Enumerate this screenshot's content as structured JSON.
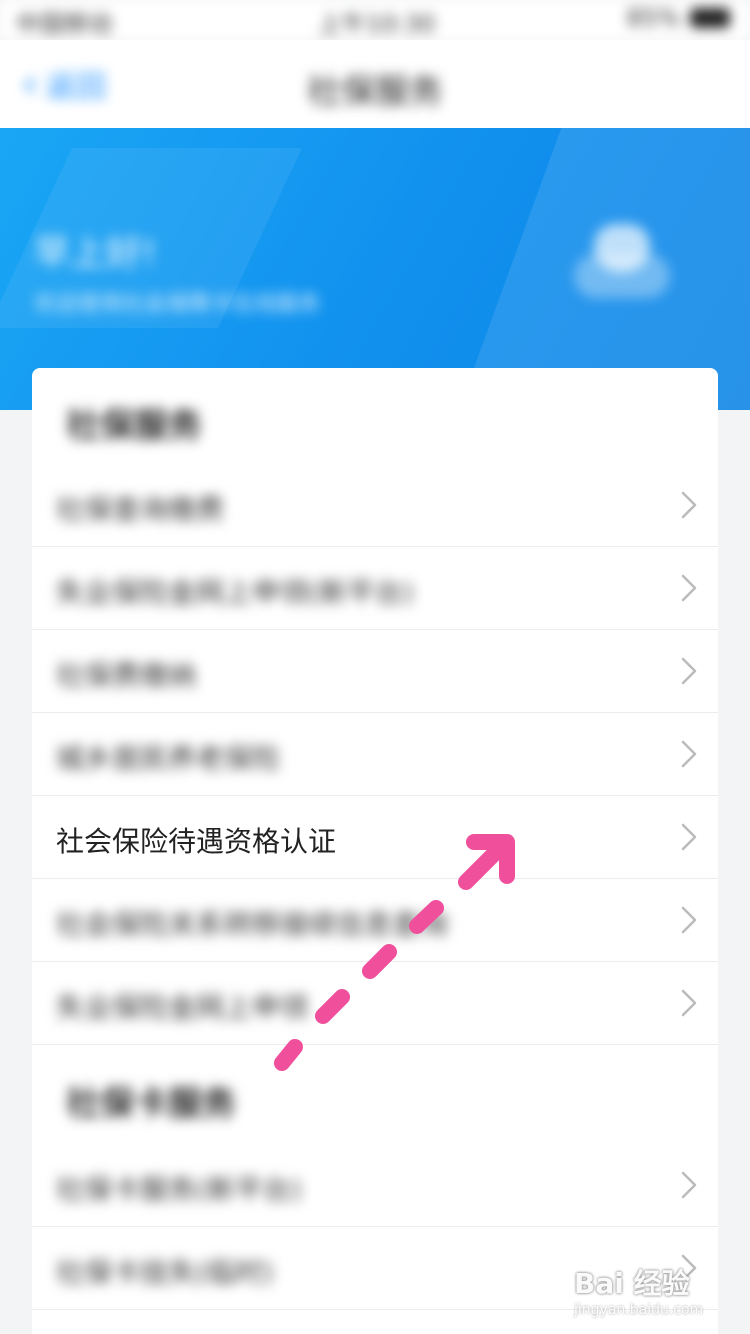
{
  "status_bar": {
    "left": "中国移动",
    "center": "上午10:30",
    "right": "85%"
  },
  "nav": {
    "back_label": "返回",
    "title": "社保服务"
  },
  "hero": {
    "greeting": "早上好!",
    "subtitle": "欢迎使用社会保障卡在线服务"
  },
  "sections": [
    {
      "header": "社保服务",
      "items": [
        "社保查询缴费",
        "失业保险金网上申领(新平台)",
        "社保费缴纳",
        "城乡居民养老保险",
        "社会保险待遇资格认证",
        "社会保险关系转移接续信息查询",
        "失业保险金网上申领"
      ]
    },
    {
      "header": "社保卡服务",
      "items": [
        "社保卡服务(新平台)",
        "社保卡挂失(临时)"
      ]
    }
  ],
  "watermark": {
    "logo": "Bai 经验",
    "url": "jingyan.baidu.com"
  },
  "colors": {
    "hero": "#1190ee",
    "accent": "#1e90ff",
    "annotation": "#f0509b"
  }
}
